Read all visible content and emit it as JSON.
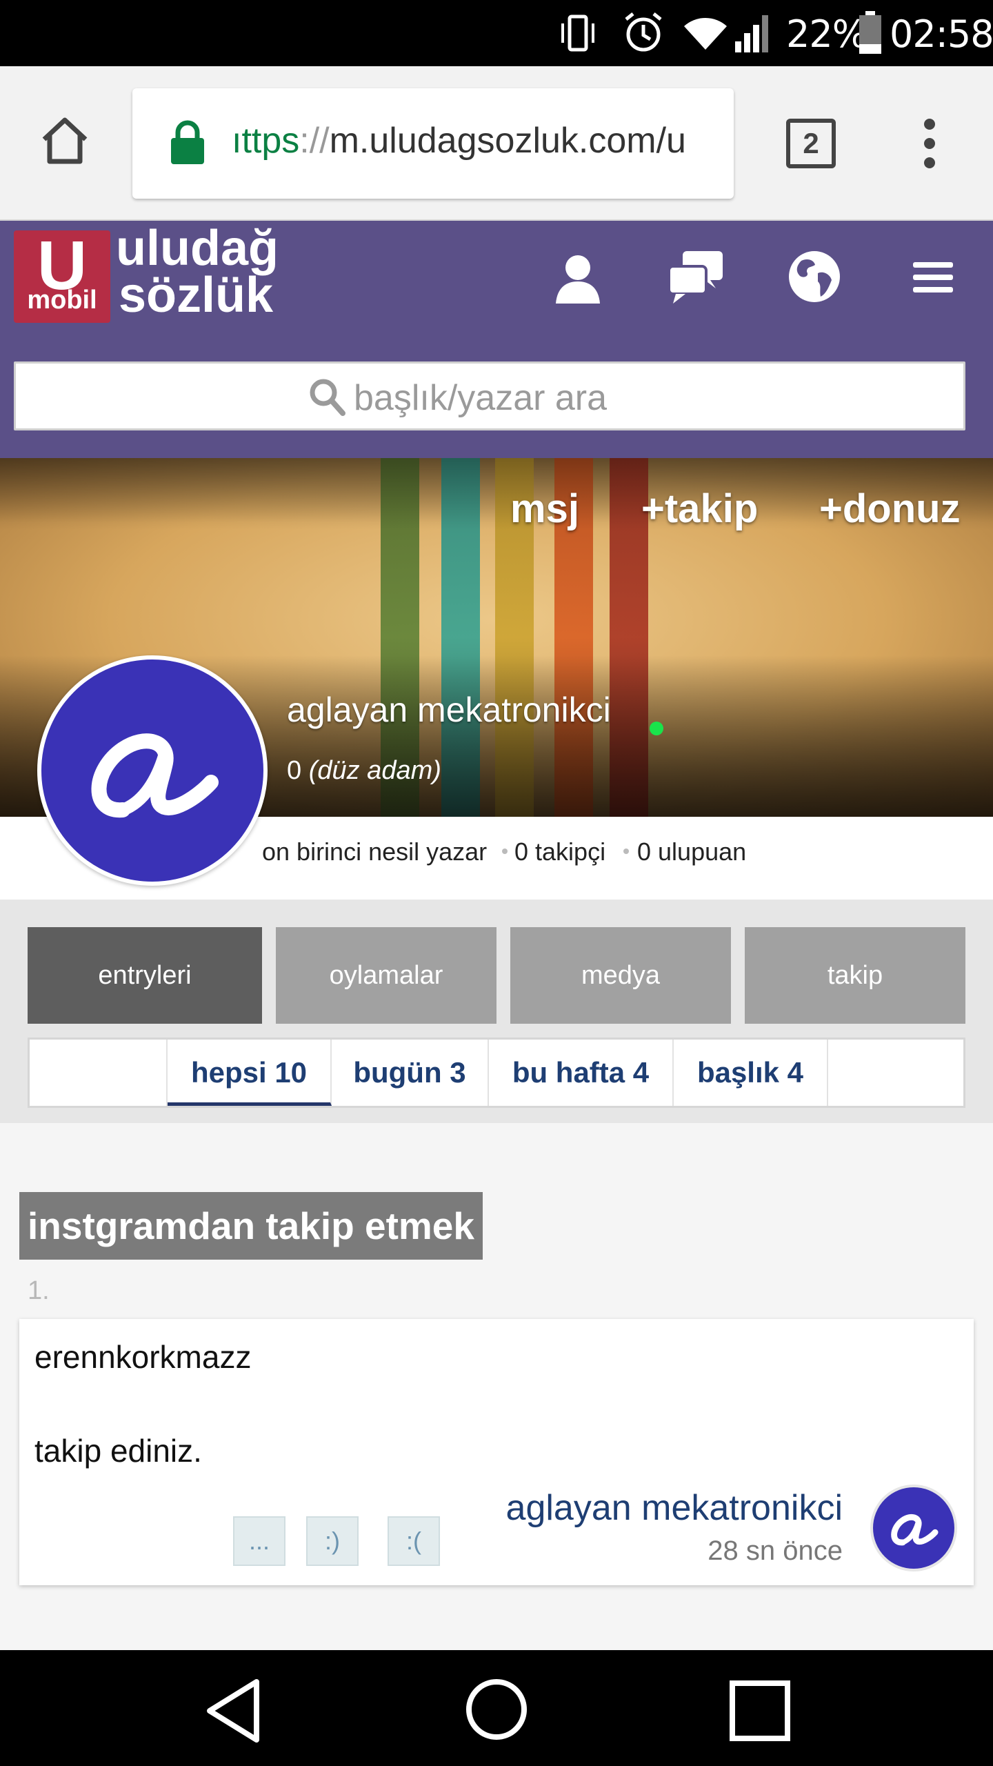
{
  "status_bar": {
    "battery": "22%",
    "time": "02:58"
  },
  "browser": {
    "url_scheme": "https",
    "url_separator": "://",
    "url_rest": "m.uludagsozluk.com/u",
    "url_visible_prefix": "ıttps",
    "tab_count": "2"
  },
  "site": {
    "logo_badge_top": "U",
    "logo_badge_bottom": "mobil",
    "logo_line1": "uludağ",
    "logo_line2": "sözlük",
    "search_placeholder": "başlık/yazar ara"
  },
  "profile": {
    "actions": [
      "msj",
      "+takip",
      "+donuz"
    ],
    "username": "aglayan mekatronikci",
    "rank_points": "0",
    "rank_title": "(düz adam)",
    "generation": "on birinci nesil yazar",
    "followers": "0 takipçi",
    "points": "0 ulupuan"
  },
  "tabs": [
    "entryleri",
    "oylamalar",
    "medya",
    "takip"
  ],
  "filters": [
    "hepsi 10",
    "bugün 3",
    "bu hafta 4",
    "başlık 4"
  ],
  "entry": {
    "topic": "instgramdan takip etmek",
    "number": "1.",
    "lines": [
      "erennkorkmazz",
      "takip ediniz."
    ],
    "votes": [
      "...",
      ":)",
      ":("
    ],
    "author": "aglayan mekatronikci",
    "time": "28 sn önce"
  },
  "colors": {
    "header_bg": "#5b5088",
    "logo_red": "#b52d45",
    "avatar_blue": "#3a32b6",
    "link_blue": "#1e3e73"
  }
}
